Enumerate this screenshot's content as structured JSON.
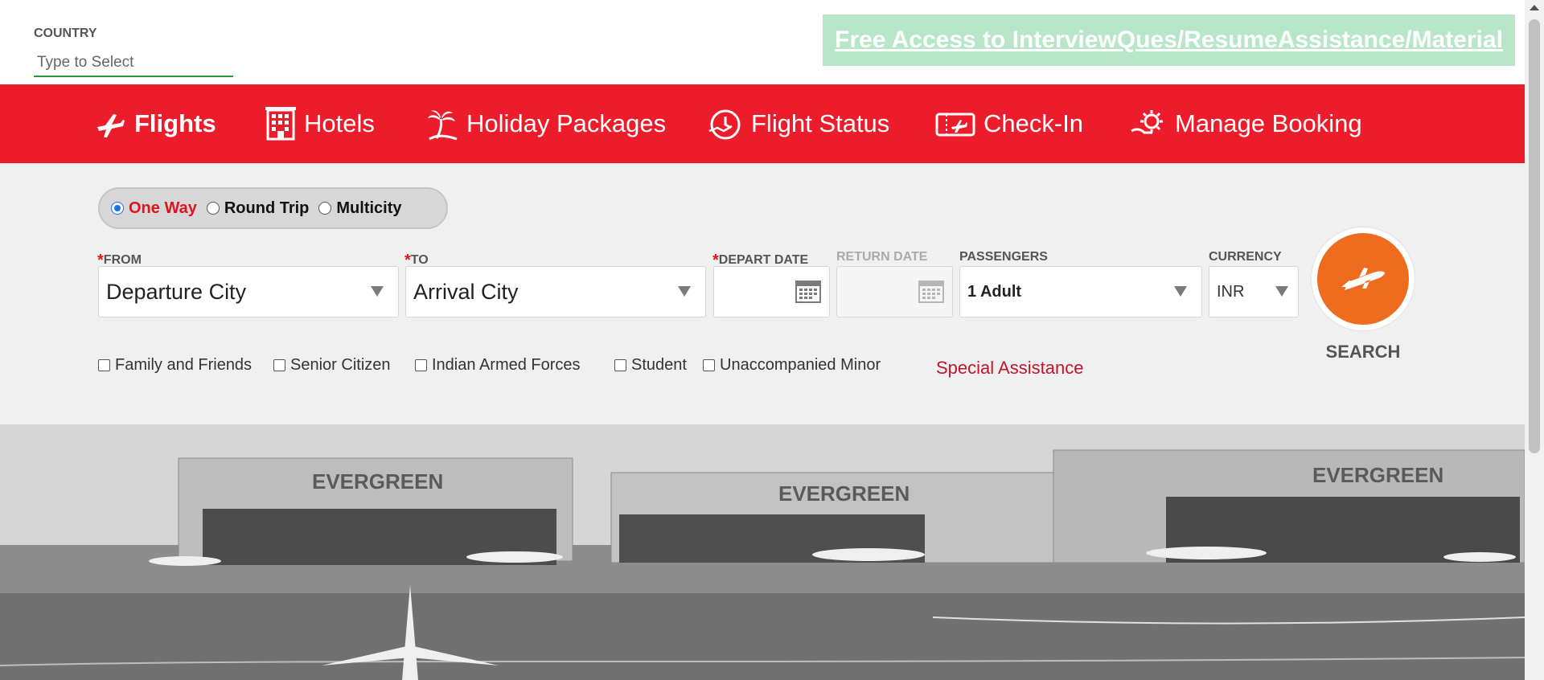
{
  "header": {
    "country_label": "COUNTRY",
    "country_placeholder": "Type to Select",
    "promo_link": "Free Access to InterviewQues/ResumeAssistance/Material"
  },
  "nav": {
    "items": [
      {
        "label": "Flights",
        "icon": "plane-icon",
        "active": true
      },
      {
        "label": "Hotels",
        "icon": "hotel-icon",
        "active": false
      },
      {
        "label": "Holiday Packages",
        "icon": "palm-tree-icon",
        "active": false
      },
      {
        "label": "Flight Status",
        "icon": "clock-status-icon",
        "active": false
      },
      {
        "label": "Check-In",
        "icon": "ticket-icon",
        "active": false
      },
      {
        "label": "Manage Booking",
        "icon": "gear-hand-icon",
        "active": false
      }
    ]
  },
  "trip_type": {
    "options": [
      "One Way",
      "Round Trip",
      "Multicity"
    ],
    "selected": "One Way"
  },
  "fields": {
    "from_label": "FROM",
    "from_value": "Departure City",
    "to_label": "TO",
    "to_value": "Arrival City",
    "depart_label": "DEPART DATE",
    "return_label": "RETURN DATE",
    "passengers_label": "PASSENGERS",
    "passengers_value": "1 Adult",
    "currency_label": "CURRENCY",
    "currency_value": "INR",
    "required_mark": "*"
  },
  "search_button": {
    "label": "SEARCH",
    "icon": "plane-takeoff-icon"
  },
  "discounts": {
    "options": [
      "Family and Friends",
      "Senior Citizen",
      "Indian Armed Forces",
      "Student",
      "Unaccompanied Minor"
    ],
    "special_assistance": "Special Assistance"
  },
  "hero": {
    "hangar_text": "EVERGREEN"
  },
  "colors": {
    "brand_red": "#ec1c2b",
    "search_orange": "#ef6c1f",
    "promo_green": "#b7e6c8",
    "country_underline": "#1e9e3e"
  }
}
